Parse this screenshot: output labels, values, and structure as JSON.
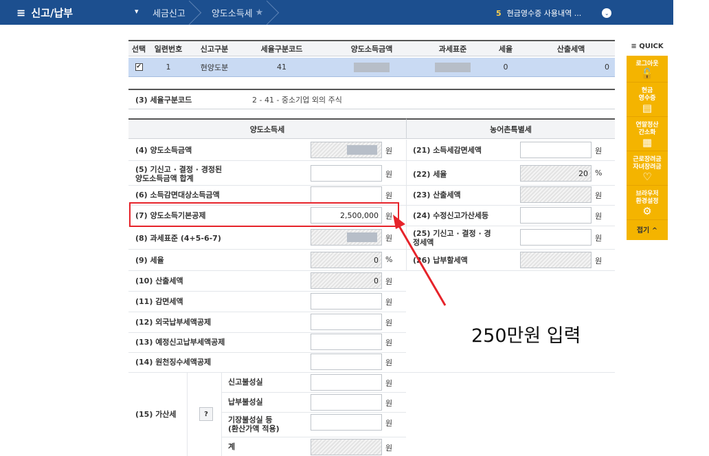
{
  "topbar": {
    "menu_label": "신고/납부",
    "crumbs": [
      "세금신고",
      "양도소득세"
    ],
    "notice_num": "5",
    "notice_text": "현금영수증 사용내역 ..."
  },
  "table": {
    "headers": [
      "선택",
      "일련번호",
      "신고구분",
      "세율구분코드",
      "양도소득금액",
      "과세표준",
      "세율",
      "산출세액"
    ],
    "row": {
      "checked": "✔",
      "seq": "1",
      "type": "현양도분",
      "rate_code": "41",
      "rate": "0",
      "tax": "0"
    }
  },
  "code": {
    "label": "(3) 세율구분코드",
    "value": "2 - 41 - 중소기업 외의 주식"
  },
  "sections": {
    "left": "양도소득세",
    "right": "농어촌특별세"
  },
  "unit_won": "원",
  "unit_pct": "%",
  "left_fields": [
    {
      "label": "(4) 양도소득금액",
      "value": ""
    },
    {
      "label": "(5) 기신고 · 결정 · 경정된\n양도소득금액 합계",
      "value": ""
    },
    {
      "label": "(6) 소득감면대상소득금액",
      "value": ""
    },
    {
      "label": "(7) 양도소득기본공제",
      "value": "2,500,000"
    },
    {
      "label": "(8) 과세표준 (4+5-6-7)",
      "value": ""
    },
    {
      "label": "(9) 세율",
      "value": "0"
    },
    {
      "label": "(10) 산출세액",
      "value": "0"
    },
    {
      "label": "(11) 감면세액",
      "value": ""
    },
    {
      "label": "(12) 외국납부세액공제",
      "value": ""
    },
    {
      "label": "(13) 예정신고납부세액공제",
      "value": ""
    },
    {
      "label": "(14) 원천징수세액공제",
      "value": ""
    }
  ],
  "penalty": {
    "label": "(15) 가산세",
    "help": "?",
    "items": [
      "신고불성실",
      "납부불성실",
      "기장불성실 등\n(환산가액 적용)",
      "계"
    ]
  },
  "right_fields": [
    {
      "label": "(21) 소득세감면세액",
      "value": ""
    },
    {
      "label": "(22) 세율",
      "value": "20"
    },
    {
      "label": "(23) 산출세액",
      "value": ""
    },
    {
      "label": "(24) 수정신고가산세등",
      "value": ""
    },
    {
      "label": "(25) 기신고 · 결정 · 경\n정세액",
      "value": ""
    },
    {
      "label": "(26) 납부할세액",
      "value": ""
    }
  ],
  "annotation": "250만원 입력",
  "quick": {
    "title": "≡ QUICK",
    "items": [
      "로그아웃",
      "현금\n영수증",
      "연말정산\n간소화",
      "근로장려금\n자녀장려금",
      "브라우저\n환경설정"
    ],
    "close": "접기 ^"
  }
}
